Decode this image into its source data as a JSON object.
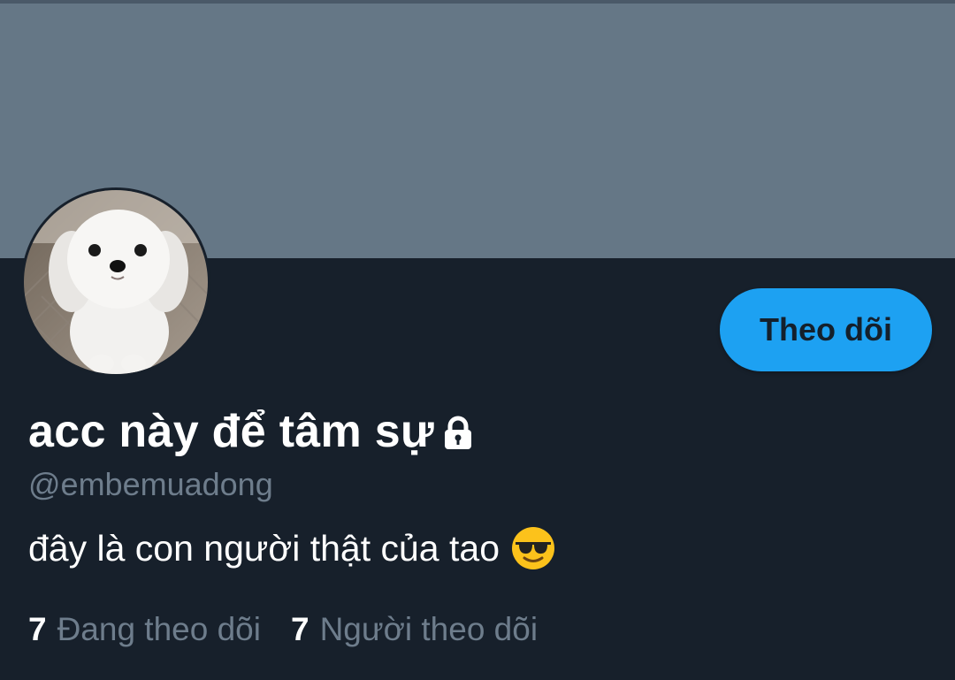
{
  "profile": {
    "display_name": "acc này để tâm sự",
    "handle": "@embemuadong",
    "bio": "đây là con người thật của tao",
    "bio_emoji": "smiling-face-with-sunglasses-icon",
    "lock_icon": "lock-icon"
  },
  "actions": {
    "follow_label": "Theo dõi"
  },
  "stats": {
    "following_count": "7",
    "following_label": "Đang theo dõi",
    "followers_count": "7",
    "followers_label": "Người theo dõi"
  },
  "colors": {
    "banner": "#657786",
    "background": "#17202b",
    "accent": "#1da1f2",
    "muted_text": "#6e7d8c"
  }
}
